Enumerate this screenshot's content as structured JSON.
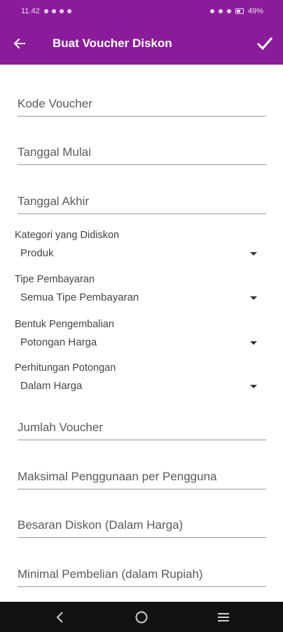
{
  "status": {
    "time": "11.42",
    "battery": "49%"
  },
  "appbar": {
    "title": "Buat Voucher Diskon"
  },
  "form": {
    "kode_voucher": {
      "placeholder": "Kode Voucher"
    },
    "tanggal_mulai": {
      "placeholder": "Tanggal Mulai"
    },
    "tanggal_akhir": {
      "placeholder": "Tanggal Akhir"
    },
    "kategori": {
      "label": "Kategori yang Didiskon",
      "value": "Produk"
    },
    "tipe_pembayaran": {
      "label": "Tipe Pembayaran",
      "value": "Semua Tipe Pembayaran"
    },
    "bentuk_pengembalian": {
      "label": "Bentuk Pengembalian",
      "value": "Potongan Harga"
    },
    "perhitungan_potongan": {
      "label": "Perhitungan Potongan",
      "value": "Dalam Harga"
    },
    "jumlah_voucher": {
      "placeholder": "Jumlah Voucher"
    },
    "maksimal_penggunaan": {
      "placeholder": "Maksimal Penggunaan per Pengguna"
    },
    "besaran_diskon": {
      "placeholder": "Besaran Diskon (Dalam Harga)"
    },
    "minimal_pembelian": {
      "placeholder": "Minimal Pembelian (dalam Rupiah)"
    }
  },
  "colors": {
    "appbar": "#8a1c9a",
    "navbar": "#111111"
  }
}
